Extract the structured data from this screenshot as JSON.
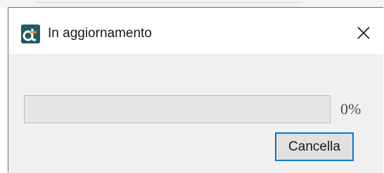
{
  "window": {
    "title": "In aggiornamento",
    "app_icon": "app-logo-icon",
    "close_icon": "close-icon"
  },
  "progress": {
    "value": 0,
    "label": "0%"
  },
  "buttons": {
    "cancel_label": "Cancella"
  },
  "colors": {
    "app_icon_bg": "#1f5b63",
    "app_icon_accent": "#e88a3c",
    "button_border": "#0078d7",
    "client_bg": "#f0f0f0"
  }
}
